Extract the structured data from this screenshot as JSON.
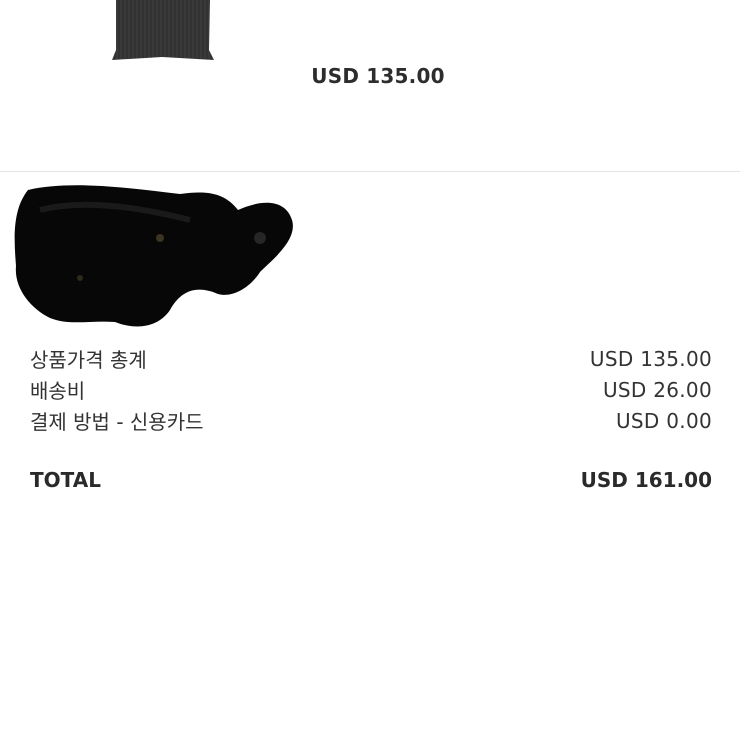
{
  "product": {
    "price": "USD 135.00"
  },
  "summary": {
    "rows": [
      {
        "label": "상품가격 총계",
        "value": "USD 135.00"
      },
      {
        "label": "배송비",
        "value": "USD 26.00"
      },
      {
        "label": "결제 방법 - 신용카드",
        "value": "USD 0.00"
      }
    ],
    "total_label": "TOTAL",
    "total_value": "USD 161.00"
  }
}
